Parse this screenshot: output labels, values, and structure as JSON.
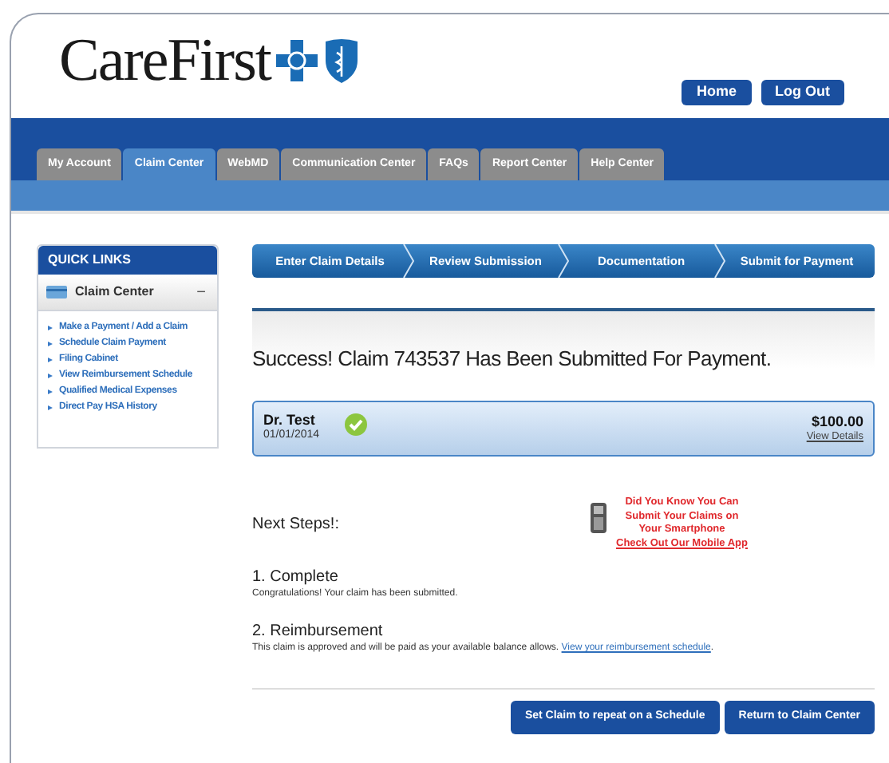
{
  "logo": {
    "text": "CareFirst"
  },
  "header_buttons": [
    "Home",
    "Log Out"
  ],
  "tabs": [
    {
      "label": "My Account",
      "selected": false
    },
    {
      "label": "Claim Center",
      "selected": true
    },
    {
      "label": "WebMD",
      "selected": false
    },
    {
      "label": "Communication Center",
      "selected": false
    },
    {
      "label": "FAQs",
      "selected": false
    },
    {
      "label": "Report Center",
      "selected": false
    },
    {
      "label": "Help Center",
      "selected": false
    }
  ],
  "quick_links": {
    "title": "QUICK LINKS",
    "section": "Claim Center",
    "toggle": "−",
    "expanded": true,
    "items": [
      "Make a Payment / Add a Claim",
      "Schedule Claim Payment",
      "Filing Cabinet",
      "View Reimbursement Schedule",
      "Qualified Medical Expenses",
      "Direct Pay HSA History"
    ]
  },
  "steps": [
    "Enter Claim Details",
    "Review Submission",
    "Documentation",
    "Submit for Payment"
  ],
  "success_title": "Success! Claim 743537 Has Been Submitted For Payment.",
  "claim": {
    "provider": "Dr. Test",
    "date": "01/01/2014",
    "amount": "$100.00",
    "link": "View Details",
    "approved": true
  },
  "next_steps_title": "Next Steps!:",
  "promo": {
    "lines": [
      "Did You Know You Can",
      "Submit Your Claims on",
      "Your Smartphone"
    ],
    "link": "Check Out Our Mobile App"
  },
  "next_steps": [
    {
      "heading": "1. Complete",
      "text": "Congratulations! Your claim has been submitted."
    },
    {
      "heading": "2. Reimbursement",
      "text": "This claim is approved and will be paid as your available balance allows.",
      "link": "View your reimbursement schedule",
      "after": "."
    }
  ],
  "buttons": [
    "Set Claim to repeat on a Schedule",
    "Return to Claim Center"
  ]
}
